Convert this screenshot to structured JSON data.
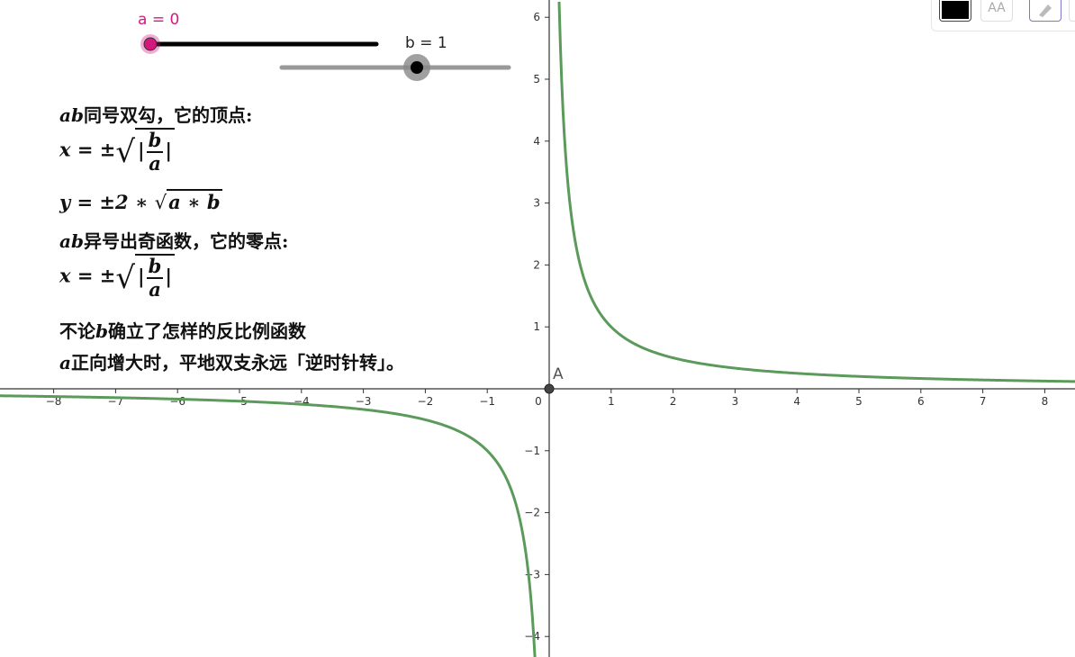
{
  "sliders": {
    "a": {
      "label": "a = 0",
      "value": 0,
      "min": 0,
      "max": 1,
      "color": "#d4197e"
    },
    "b": {
      "label": "b = 1",
      "value": 1,
      "min": -5,
      "max": 5,
      "color": "#000000"
    }
  },
  "text_lines": [
    "ab同号双勾，它的顶点:",
    "x = ±√|b/a|",
    "y = ±2 * √(a * b)",
    "ab异号出奇函数，它的零点:",
    "x = ±√|b/a|",
    "不论b确立了怎样的反比例函数",
    "a正向增大时，平地双支永远「逆时针转」。"
  ],
  "text": {
    "l1_var": "ab",
    "l1_rest": "同号双勾，它的顶点:",
    "l2_lhs": "x = ±",
    "frac_num": "b",
    "frac_den": "a",
    "bar": "|",
    "l3_lhs": "y = ±2 ∗ ",
    "l3_rad": "a ∗ b",
    "l4_var": "ab",
    "l4_rest": "异号出奇函数，它的零点:",
    "l6_pre": "不论",
    "l6_var": "b",
    "l6_rest": "确立了怎样的反比例函数",
    "l7_var": "a",
    "l7_rest": "正向增大时，平地双支永远「逆时针转」。"
  },
  "point": {
    "label": "A",
    "x": 0,
    "y": 0
  },
  "chart_data": {
    "type": "line",
    "function": "y = 1/x",
    "series": [
      {
        "x": [
          0.16,
          0.2,
          0.25,
          0.33,
          0.5,
          1,
          2,
          3,
          4,
          5,
          6,
          7,
          8,
          8.5
        ],
        "y": [
          6.25,
          5,
          4,
          3.03,
          2,
          1,
          0.5,
          0.333,
          0.25,
          0.2,
          0.167,
          0.143,
          0.125,
          0.118
        ]
      },
      {
        "x": [
          -9,
          -8,
          -7,
          -6,
          -5,
          -4,
          -3,
          -2,
          -1,
          -0.5,
          -0.33,
          -0.25,
          -0.23
        ],
        "y": [
          -0.111,
          -0.125,
          -0.143,
          -0.167,
          -0.2,
          -0.25,
          -0.333,
          -0.5,
          -1,
          -2,
          -3.03,
          -4,
          -4.35
        ]
      }
    ],
    "xlim": [
      -8.9,
      8.5
    ],
    "ylim": [
      -4.3,
      6.3
    ],
    "x_ticks": [
      "−8",
      "−7",
      "−6",
      "−5",
      "−4",
      "−3",
      "−2",
      "−1",
      "0",
      "1",
      "2",
      "3",
      "4",
      "5",
      "6",
      "7",
      "8"
    ],
    "y_ticks": [
      "6",
      "5",
      "4",
      "3",
      "2",
      "1",
      "−1",
      "−2",
      "−3",
      "−4"
    ],
    "curve_color": "#5b9a5b",
    "grid": false
  },
  "toolbar": {
    "items": [
      "color-swatch",
      "text-size",
      "pen-style"
    ],
    "text_size_label": "AA",
    "swatch_color": "#000000"
  }
}
